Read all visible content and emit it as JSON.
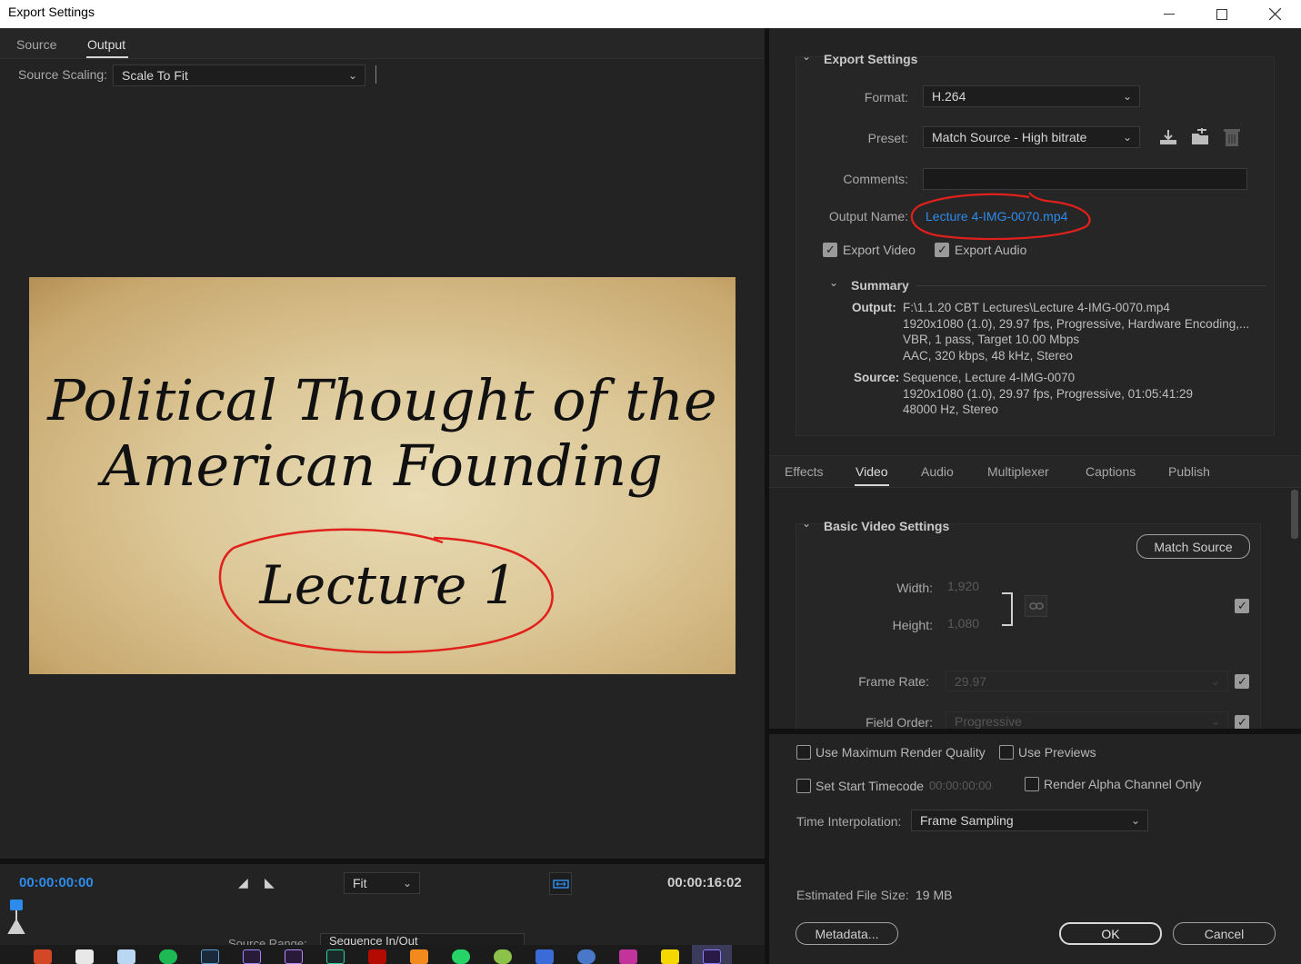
{
  "window": {
    "title": "Export Settings"
  },
  "left": {
    "tabs": [
      {
        "label": "Source"
      },
      {
        "label": "Output"
      }
    ],
    "source_scaling_label": "Source Scaling:",
    "source_scaling_value": "Scale To Fit",
    "video_frame": {
      "title_line1": "Political Thought of the",
      "title_line2": "American Founding",
      "subtitle": "Lecture 1"
    },
    "timecode_start": "00:00:00:00",
    "timecode_end": "00:00:16:02",
    "zoom_value": "Fit",
    "source_range_label": "Source Range:",
    "source_range_value": "Sequence In/Out"
  },
  "export_settings": {
    "header": "Export Settings",
    "format_label": "Format:",
    "format_value": "H.264",
    "preset_label": "Preset:",
    "preset_value": "Match Source - High bitrate",
    "comments_label": "Comments:",
    "comments_value": "",
    "output_name_label": "Output Name:",
    "output_name_value": "Lecture 4-IMG-0070.mp4",
    "export_video_label": "Export Video",
    "export_video_checked": true,
    "export_audio_label": "Export Audio",
    "export_audio_checked": true,
    "summary_header": "Summary",
    "output_key": "Output:",
    "output_lines": [
      "F:\\1.1.20 CBT Lectures\\Lecture 4-IMG-0070.mp4",
      "1920x1080 (1.0), 29.97 fps, Progressive, Hardware Encoding,...",
      "VBR, 1 pass, Target 10.00 Mbps",
      "AAC, 320 kbps, 48 kHz, Stereo"
    ],
    "source_key": "Source:",
    "source_lines": [
      "Sequence, Lecture 4-IMG-0070",
      "1920x1080 (1.0), 29.97 fps, Progressive, 01:05:41:29",
      "48000 Hz, Stereo"
    ]
  },
  "settings_tabs": [
    {
      "label": "Effects"
    },
    {
      "label": "Video"
    },
    {
      "label": "Audio"
    },
    {
      "label": "Multiplexer"
    },
    {
      "label": "Captions"
    },
    {
      "label": "Publish"
    }
  ],
  "basic_video": {
    "header": "Basic Video Settings",
    "match_source_label": "Match Source",
    "width_label": "Width:",
    "width_value": "1,920",
    "height_label": "Height:",
    "height_value": "1,080",
    "frame_rate_label": "Frame Rate:",
    "frame_rate_value": "29.97",
    "field_order_label": "Field Order:",
    "field_order_value": "Progressive"
  },
  "bottom": {
    "max_render_label": "Use Maximum Render Quality",
    "use_previews_label": "Use Previews",
    "start_timecode_label": "Set Start Timecode",
    "start_timecode_value": "00:00:00:00",
    "alpha_only_label": "Render Alpha Channel Only",
    "time_interp_label": "Time Interpolation:",
    "time_interp_value": "Frame Sampling",
    "file_size_label": "Estimated File Size:",
    "file_size_value": "19 MB",
    "metadata_label": "Metadata...",
    "ok_label": "OK",
    "cancel_label": "Cancel"
  },
  "colors": {
    "accent_blue": "#2d8ceb",
    "annotation_red": "#e0201b",
    "background": "#232323"
  }
}
